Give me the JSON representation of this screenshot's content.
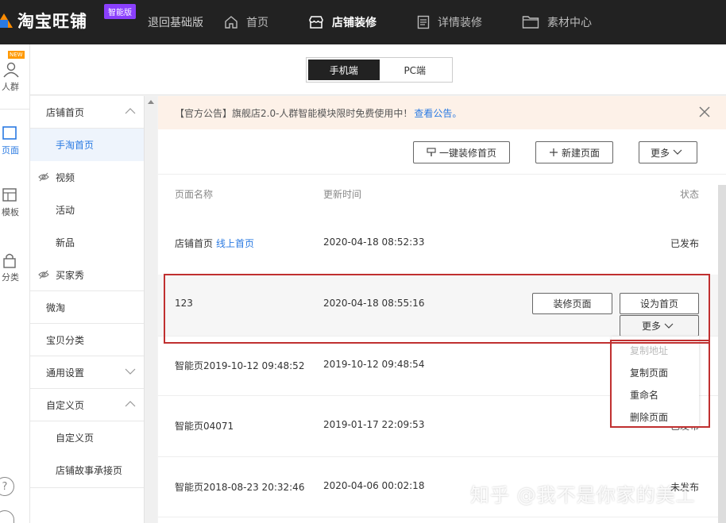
{
  "header": {
    "logo_text": "淘宝旺铺",
    "badge": "智能版",
    "back_basic": "退回基础版",
    "nav": [
      {
        "label": "首页",
        "icon": "home-icon"
      },
      {
        "label": "店铺装修",
        "icon": "store-icon",
        "active": true
      },
      {
        "label": "详情装修",
        "icon": "document-icon"
      },
      {
        "label": "素材中心",
        "icon": "folder-icon"
      }
    ]
  },
  "rail": {
    "new_tag": "NEW",
    "items": [
      {
        "label": "人群",
        "icon": "user-icon"
      },
      {
        "label": "页面",
        "icon": "page-icon",
        "active": true
      },
      {
        "label": "模板",
        "icon": "template-icon"
      },
      {
        "label": "分类",
        "icon": "lock-icon"
      }
    ],
    "help": "?"
  },
  "device_toggle": {
    "mobile": "手机端",
    "pc": "PC端"
  },
  "sidebar": {
    "groups": [
      {
        "label": "店铺首页"
      },
      {
        "label": "手淘首页"
      },
      {
        "label": "视频"
      },
      {
        "label": "活动"
      },
      {
        "label": "新品"
      },
      {
        "label": "买家秀"
      },
      {
        "label": "微淘"
      },
      {
        "label": "宝贝分类"
      },
      {
        "label": "通用设置"
      },
      {
        "label": "自定义页"
      },
      {
        "label": "自定义页"
      },
      {
        "label": "店铺故事承接页"
      }
    ]
  },
  "notice": {
    "text": "【官方公告】旗舰店2.0-人群智能模块限时免费使用中！",
    "link": "查看公告。"
  },
  "toolbar": {
    "one_click": "一键装修首页",
    "new_page": "新建页面",
    "more": "更多"
  },
  "table": {
    "headers": {
      "name": "页面名称",
      "updated": "更新时间",
      "status": "状态"
    },
    "rows": [
      {
        "name": "店铺首页",
        "tag": "线上首页",
        "updated": "2020-04-18 08:52:33",
        "status": "已发布"
      },
      {
        "name": "123",
        "updated": "2020-04-18 08:55:16",
        "decorate": "装修页面",
        "set_home": "设为首页",
        "more": "更多"
      },
      {
        "name": "智能页2019-10-12 09:48:52",
        "updated": "2019-10-12 09:48:54"
      },
      {
        "name": "智能页04071",
        "updated": "2019-01-17 22:09:53",
        "status": "已发布"
      },
      {
        "name": "智能页2018-08-23 20:32:46",
        "updated": "2020-04-06 00:02:18",
        "status": "未发布"
      }
    ]
  },
  "dropdown": {
    "items": [
      {
        "label": "复制地址",
        "disabled": true
      },
      {
        "label": "复制页面"
      },
      {
        "label": "重命名"
      },
      {
        "label": "删除页面"
      }
    ]
  },
  "watermark": "知乎 @我不是你家的美工",
  "colors": {
    "accent": "#2a7ae2",
    "highlight_outline": "#c03030",
    "header_bg": "#222222",
    "badge": "#8a3ffc"
  }
}
